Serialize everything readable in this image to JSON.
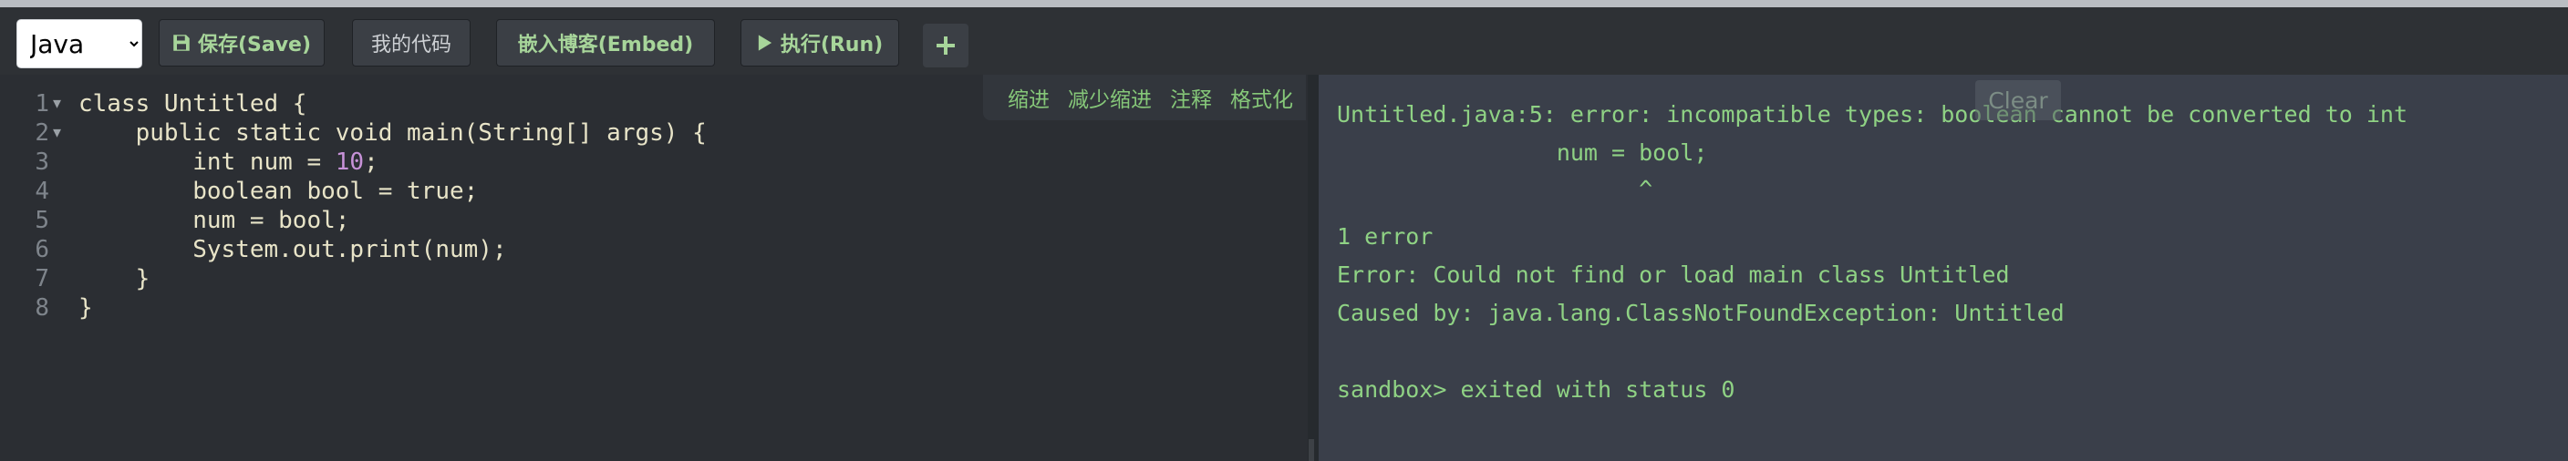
{
  "toolbar": {
    "language_options": [
      "Java"
    ],
    "language_selected": "Java",
    "save_label": "保存(Save)",
    "my_code_label": "我的代码",
    "embed_label": "嵌入博客(Embed)",
    "run_label": "执行(Run)",
    "add_icon": "plus-icon",
    "save_icon": "floppy-disk-icon",
    "run_icon": "play-icon"
  },
  "editor_tools": {
    "indent": "缩进",
    "outdent": "减少缩进",
    "comment": "注释",
    "format": "格式化"
  },
  "editor": {
    "lines": [
      {
        "no": "1",
        "fold": "▾",
        "pre": "class Untitled {",
        "num": "",
        "post": ""
      },
      {
        "no": "2",
        "fold": "▾",
        "pre": "    public static void main(String[] args) {",
        "num": "",
        "post": ""
      },
      {
        "no": "3",
        "fold": "",
        "pre": "        int num = ",
        "num": "10",
        "post": ";"
      },
      {
        "no": "4",
        "fold": "",
        "pre": "        boolean bool = true;",
        "num": "",
        "post": ""
      },
      {
        "no": "5",
        "fold": "",
        "pre": "        num = bool;",
        "num": "",
        "post": ""
      },
      {
        "no": "6",
        "fold": "",
        "pre": "        System.out.print(num);",
        "num": "",
        "post": ""
      },
      {
        "no": "7",
        "fold": "",
        "pre": "    }",
        "num": "",
        "post": ""
      },
      {
        "no": "8",
        "fold": "",
        "pre": "}",
        "num": "",
        "post": ""
      }
    ]
  },
  "output": {
    "clear_label": "Clear",
    "lines": [
      "Untitled.java:5: error: incompatible types: boolean cannot be converted to int",
      "                num = bool;",
      "                      ^",
      "1 error",
      "Error: Could not find or load main class Untitled",
      "Caused by: java.lang.ClassNotFoundException: Untitled",
      "",
      "sandbox> exited with status 0"
    ]
  },
  "colors": {
    "accent_green": "#8fd284",
    "editor_bg": "#2b2e33",
    "output_bg": "#3a3f4a",
    "number_purple": "#c792d8"
  }
}
